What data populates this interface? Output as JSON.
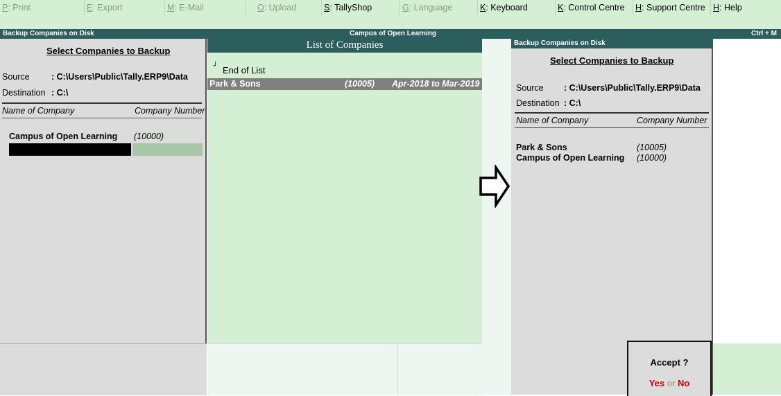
{
  "topbar": [
    {
      "key": "P",
      "label": ": Print",
      "dim": true
    },
    {
      "key": "E",
      "label": ": Export",
      "dim": true
    },
    {
      "key": "M",
      "label": ": E-Mail",
      "dim": true
    },
    {
      "key": "O",
      "label": ": Upload",
      "dim": true
    },
    {
      "key": "S",
      "label": ": TallyShop",
      "dim": false
    },
    {
      "key": "G",
      "label": ": Language",
      "dim": true
    },
    {
      "key": "K",
      "label": ": Keyboard",
      "dim": false
    },
    {
      "key": "K",
      "label": ": Control Centre",
      "dim": false
    },
    {
      "key": "H",
      "label": ": Support Centre",
      "dim": false
    },
    {
      "key": "H",
      "label": ": Help",
      "dim": false
    }
  ],
  "titlebar": {
    "left": "Backup Companies on Disk",
    "center": "Campus of Open Learning",
    "right": "Ctrl + M"
  },
  "left_panel": {
    "title": "Select Companies to Backup",
    "source_label": "Source",
    "source_value": ": C:\\Users\\Public\\Tally.ERP9\\Data",
    "dest_label": "Destination",
    "dest_value": ": C:\\",
    "col_name": "Name of Company",
    "col_number": "Company Number",
    "company_name": "Campus of Open Learning",
    "company_number": "(10000)"
  },
  "list": {
    "title": "List of Companies",
    "end_marker": "┘",
    "end_label": "End of List",
    "items": [
      {
        "name": "Park & Sons",
        "number": "(10005)",
        "period": "Apr-2018 to Mar-2019"
      }
    ]
  },
  "right_panel": {
    "header": "Backup Companies on Disk",
    "title": "Select Companies to Backup",
    "source_label": "Source",
    "source_value": ": C:\\Users\\Public\\Tally.ERP9\\Data",
    "dest_label": "Destination",
    "dest_value": ": C:\\",
    "col_name": "Name of Company",
    "col_number": "Company Number",
    "companies": [
      {
        "name": "Park & Sons",
        "number": "(10005)"
      },
      {
        "name": "Campus of Open Learning",
        "number": "(10000)"
      }
    ]
  },
  "accept": {
    "question": "Accept ?",
    "yes": "Yes",
    "or": "or",
    "no": "No"
  },
  "colors": {
    "accent_teal": "#2d5e5e",
    "panel_green": "#d4efd4",
    "danger_red": "#cc0000"
  },
  "icons": {
    "arrow": "right-arrow-outline-icon"
  }
}
